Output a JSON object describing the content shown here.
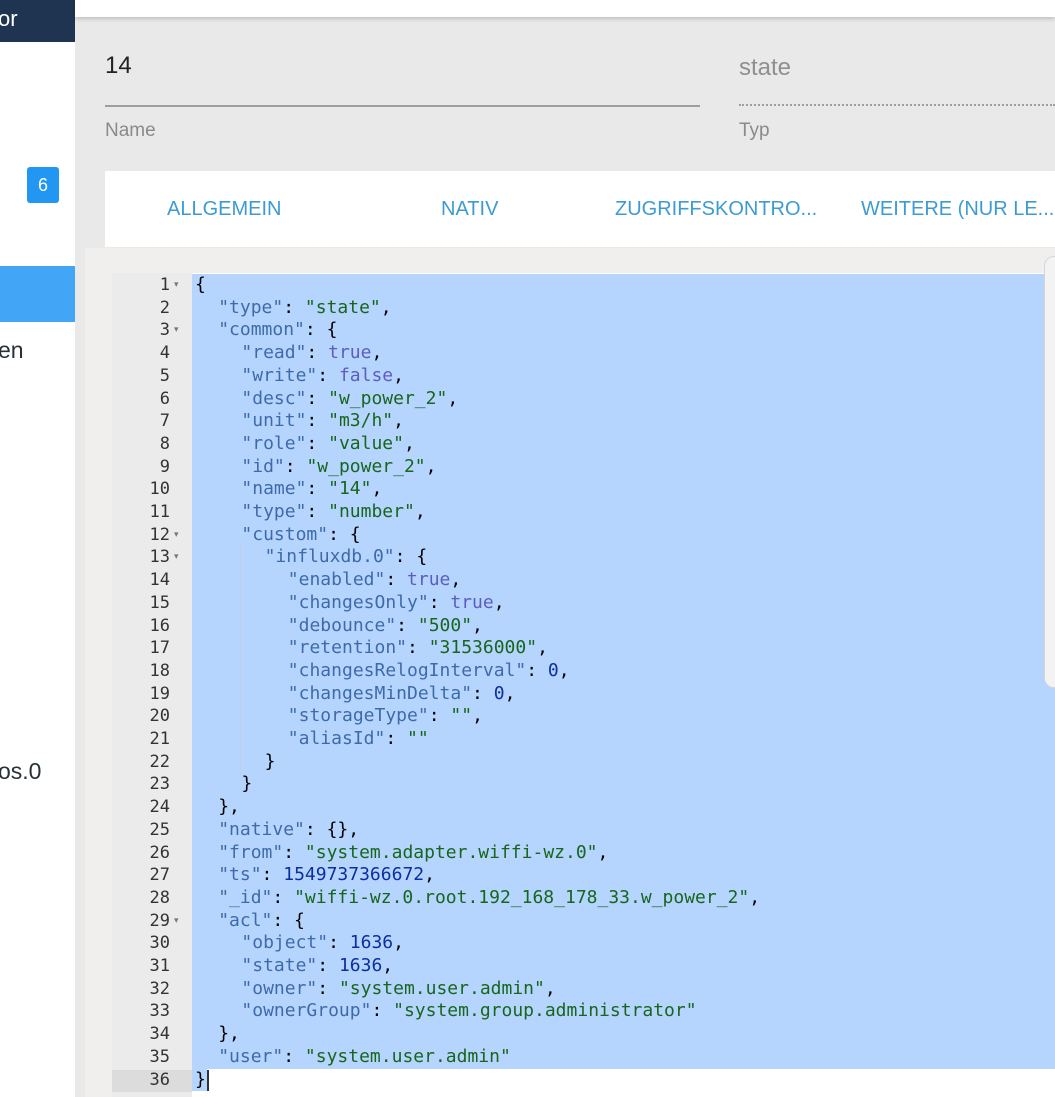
{
  "sidebar": {
    "top_text": "or",
    "badge": "6",
    "item_partial_1": "en",
    "item_partial_2": "os.0"
  },
  "fields": {
    "name_value": "14",
    "name_label": "Name",
    "type_value": "state",
    "type_label": "Typ"
  },
  "tabs": [
    {
      "label": "ALLGEMEIN"
    },
    {
      "label": "NATIV"
    },
    {
      "label": "ZUGRIFFSKONTRO..."
    },
    {
      "label": "WEITERE (NUR LE..."
    }
  ],
  "colors": {
    "accent": "#3d9bd3",
    "badge": "#2196f3",
    "selection": "#b5d5ff",
    "json_key": "#3e6ba8",
    "json_string": "#17661c",
    "json_boolean": "#5c5dbf",
    "json_number": "#0b2ea0"
  },
  "editor": {
    "lines": [
      {
        "n": "1",
        "fold": true,
        "indent": 0,
        "tokens": [
          {
            "t": "p",
            "v": "{"
          }
        ]
      },
      {
        "n": "2",
        "indent": 1,
        "tokens": [
          {
            "t": "k",
            "v": "\"type\""
          },
          {
            "t": "p",
            "v": ": "
          },
          {
            "t": "s",
            "v": "\"state\""
          },
          {
            "t": "p",
            "v": ","
          }
        ]
      },
      {
        "n": "3",
        "fold": true,
        "indent": 1,
        "tokens": [
          {
            "t": "k",
            "v": "\"common\""
          },
          {
            "t": "p",
            "v": ": {"
          }
        ]
      },
      {
        "n": "4",
        "indent": 2,
        "tokens": [
          {
            "t": "k",
            "v": "\"read\""
          },
          {
            "t": "p",
            "v": ": "
          },
          {
            "t": "b",
            "v": "true"
          },
          {
            "t": "p",
            "v": ","
          }
        ]
      },
      {
        "n": "5",
        "indent": 2,
        "tokens": [
          {
            "t": "k",
            "v": "\"write\""
          },
          {
            "t": "p",
            "v": ": "
          },
          {
            "t": "b",
            "v": "false"
          },
          {
            "t": "p",
            "v": ","
          }
        ]
      },
      {
        "n": "6",
        "indent": 2,
        "tokens": [
          {
            "t": "k",
            "v": "\"desc\""
          },
          {
            "t": "p",
            "v": ": "
          },
          {
            "t": "s",
            "v": "\"w_power_2\""
          },
          {
            "t": "p",
            "v": ","
          }
        ]
      },
      {
        "n": "7",
        "indent": 2,
        "tokens": [
          {
            "t": "k",
            "v": "\"unit\""
          },
          {
            "t": "p",
            "v": ": "
          },
          {
            "t": "s",
            "v": "\"m3/h\""
          },
          {
            "t": "p",
            "v": ","
          }
        ]
      },
      {
        "n": "8",
        "indent": 2,
        "tokens": [
          {
            "t": "k",
            "v": "\"role\""
          },
          {
            "t": "p",
            "v": ": "
          },
          {
            "t": "s",
            "v": "\"value\""
          },
          {
            "t": "p",
            "v": ","
          }
        ]
      },
      {
        "n": "9",
        "indent": 2,
        "tokens": [
          {
            "t": "k",
            "v": "\"id\""
          },
          {
            "t": "p",
            "v": ": "
          },
          {
            "t": "s",
            "v": "\"w_power_2\""
          },
          {
            "t": "p",
            "v": ","
          }
        ]
      },
      {
        "n": "10",
        "indent": 2,
        "tokens": [
          {
            "t": "k",
            "v": "\"name\""
          },
          {
            "t": "p",
            "v": ": "
          },
          {
            "t": "s",
            "v": "\"14\""
          },
          {
            "t": "p",
            "v": ","
          }
        ]
      },
      {
        "n": "11",
        "indent": 2,
        "tokens": [
          {
            "t": "k",
            "v": "\"type\""
          },
          {
            "t": "p",
            "v": ": "
          },
          {
            "t": "s",
            "v": "\"number\""
          },
          {
            "t": "p",
            "v": ","
          }
        ]
      },
      {
        "n": "12",
        "fold": true,
        "indent": 2,
        "tokens": [
          {
            "t": "k",
            "v": "\"custom\""
          },
          {
            "t": "p",
            "v": ": {"
          }
        ]
      },
      {
        "n": "13",
        "fold": true,
        "indent": 3,
        "tokens": [
          {
            "t": "k",
            "v": "\"influxdb.0\""
          },
          {
            "t": "p",
            "v": ": {"
          }
        ]
      },
      {
        "n": "14",
        "indent": 4,
        "tokens": [
          {
            "t": "k",
            "v": "\"enabled\""
          },
          {
            "t": "p",
            "v": ": "
          },
          {
            "t": "b",
            "v": "true"
          },
          {
            "t": "p",
            "v": ","
          }
        ]
      },
      {
        "n": "15",
        "indent": 4,
        "tokens": [
          {
            "t": "k",
            "v": "\"changesOnly\""
          },
          {
            "t": "p",
            "v": ": "
          },
          {
            "t": "b",
            "v": "true"
          },
          {
            "t": "p",
            "v": ","
          }
        ]
      },
      {
        "n": "16",
        "indent": 4,
        "tokens": [
          {
            "t": "k",
            "v": "\"debounce\""
          },
          {
            "t": "p",
            "v": ": "
          },
          {
            "t": "s",
            "v": "\"500\""
          },
          {
            "t": "p",
            "v": ","
          }
        ]
      },
      {
        "n": "17",
        "indent": 4,
        "tokens": [
          {
            "t": "k",
            "v": "\"retention\""
          },
          {
            "t": "p",
            "v": ": "
          },
          {
            "t": "s",
            "v": "\"31536000\""
          },
          {
            "t": "p",
            "v": ","
          }
        ]
      },
      {
        "n": "18",
        "indent": 4,
        "tokens": [
          {
            "t": "k",
            "v": "\"changesRelogInterval\""
          },
          {
            "t": "p",
            "v": ": "
          },
          {
            "t": "n",
            "v": "0"
          },
          {
            "t": "p",
            "v": ","
          }
        ]
      },
      {
        "n": "19",
        "indent": 4,
        "tokens": [
          {
            "t": "k",
            "v": "\"changesMinDelta\""
          },
          {
            "t": "p",
            "v": ": "
          },
          {
            "t": "n",
            "v": "0"
          },
          {
            "t": "p",
            "v": ","
          }
        ]
      },
      {
        "n": "20",
        "indent": 4,
        "tokens": [
          {
            "t": "k",
            "v": "\"storageType\""
          },
          {
            "t": "p",
            "v": ": "
          },
          {
            "t": "s",
            "v": "\"\""
          },
          {
            "t": "p",
            "v": ","
          }
        ]
      },
      {
        "n": "21",
        "indent": 4,
        "tokens": [
          {
            "t": "k",
            "v": "\"aliasId\""
          },
          {
            "t": "p",
            "v": ": "
          },
          {
            "t": "s",
            "v": "\"\""
          }
        ]
      },
      {
        "n": "22",
        "indent": 3,
        "tokens": [
          {
            "t": "p",
            "v": "}"
          }
        ]
      },
      {
        "n": "23",
        "indent": 2,
        "tokens": [
          {
            "t": "p",
            "v": "}"
          }
        ]
      },
      {
        "n": "24",
        "indent": 1,
        "tokens": [
          {
            "t": "p",
            "v": "},"
          }
        ]
      },
      {
        "n": "25",
        "indent": 1,
        "tokens": [
          {
            "t": "k",
            "v": "\"native\""
          },
          {
            "t": "p",
            "v": ": {},"
          }
        ]
      },
      {
        "n": "26",
        "indent": 1,
        "tokens": [
          {
            "t": "k",
            "v": "\"from\""
          },
          {
            "t": "p",
            "v": ": "
          },
          {
            "t": "s",
            "v": "\"system.adapter.wiffi-wz.0\""
          },
          {
            "t": "p",
            "v": ","
          }
        ]
      },
      {
        "n": "27",
        "indent": 1,
        "tokens": [
          {
            "t": "k",
            "v": "\"ts\""
          },
          {
            "t": "p",
            "v": ": "
          },
          {
            "t": "n",
            "v": "1549737366672"
          },
          {
            "t": "p",
            "v": ","
          }
        ]
      },
      {
        "n": "28",
        "indent": 1,
        "tokens": [
          {
            "t": "k",
            "v": "\"_id\""
          },
          {
            "t": "p",
            "v": ": "
          },
          {
            "t": "s",
            "v": "\"wiffi-wz.0.root.192_168_178_33.w_power_2\""
          },
          {
            "t": "p",
            "v": ","
          }
        ]
      },
      {
        "n": "29",
        "fold": true,
        "indent": 1,
        "tokens": [
          {
            "t": "k",
            "v": "\"acl\""
          },
          {
            "t": "p",
            "v": ": {"
          }
        ]
      },
      {
        "n": "30",
        "indent": 2,
        "tokens": [
          {
            "t": "k",
            "v": "\"object\""
          },
          {
            "t": "p",
            "v": ": "
          },
          {
            "t": "n",
            "v": "1636"
          },
          {
            "t": "p",
            "v": ","
          }
        ]
      },
      {
        "n": "31",
        "indent": 2,
        "tokens": [
          {
            "t": "k",
            "v": "\"state\""
          },
          {
            "t": "p",
            "v": ": "
          },
          {
            "t": "n",
            "v": "1636"
          },
          {
            "t": "p",
            "v": ","
          }
        ]
      },
      {
        "n": "32",
        "indent": 2,
        "tokens": [
          {
            "t": "k",
            "v": "\"owner\""
          },
          {
            "t": "p",
            "v": ": "
          },
          {
            "t": "s",
            "v": "\"system.user.admin\""
          },
          {
            "t": "p",
            "v": ","
          }
        ]
      },
      {
        "n": "33",
        "indent": 2,
        "tokens": [
          {
            "t": "k",
            "v": "\"ownerGroup\""
          },
          {
            "t": "p",
            "v": ": "
          },
          {
            "t": "s",
            "v": "\"system.group.administrator\""
          }
        ]
      },
      {
        "n": "34",
        "indent": 1,
        "tokens": [
          {
            "t": "p",
            "v": "},"
          }
        ]
      },
      {
        "n": "35",
        "indent": 1,
        "tokens": [
          {
            "t": "k",
            "v": "\"user\""
          },
          {
            "t": "p",
            "v": ": "
          },
          {
            "t": "s",
            "v": "\"system.user.admin\""
          }
        ]
      },
      {
        "n": "36",
        "indent": 0,
        "tokens": [
          {
            "t": "p",
            "v": "}"
          }
        ]
      }
    ]
  }
}
